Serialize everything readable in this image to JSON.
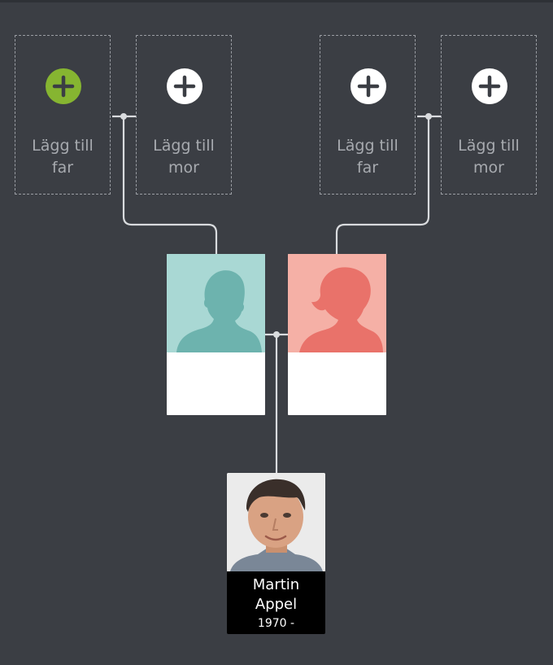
{
  "grandparents": {
    "paternal_father": {
      "line1": "Lägg till",
      "line2": "far",
      "icon": "plus-icon"
    },
    "paternal_mother": {
      "line1": "Lägg till",
      "line2": "mor",
      "icon": "plus-icon"
    },
    "maternal_father": {
      "line1": "Lägg till",
      "line2": "far",
      "icon": "plus-icon"
    },
    "maternal_mother": {
      "line1": "Lägg till",
      "line2": "mor",
      "icon": "plus-icon"
    }
  },
  "parents": {
    "father": {
      "placeholder": "male-silhouette",
      "color": "#6db3ae",
      "bg": "#a9d8d4"
    },
    "mother": {
      "placeholder": "female-silhouette",
      "color": "#e9726a",
      "bg": "#f5b0a6"
    }
  },
  "person": {
    "first_name": "Martin",
    "last_name": "Appel",
    "years": "1970 -"
  },
  "colors": {
    "background": "#3b3e44",
    "accent_green": "#86b531",
    "connector": "#d9dbde"
  }
}
